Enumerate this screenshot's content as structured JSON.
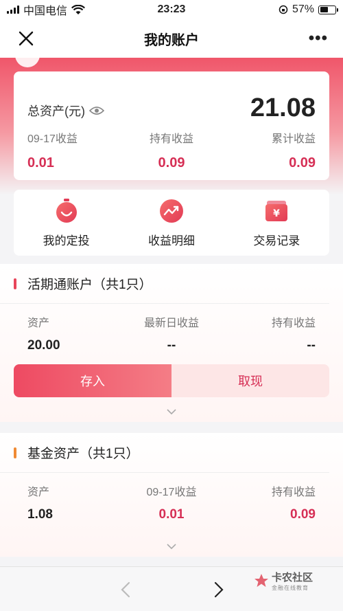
{
  "status_bar": {
    "carrier": "中国电信",
    "time": "23:23",
    "battery": "57%",
    "battery_level": 0.57
  },
  "nav": {
    "title": "我的账户"
  },
  "asset_card": {
    "label": "总资产(元)",
    "total": "21.08",
    "stats": [
      {
        "label": "09-17收益",
        "value": "0.01"
      },
      {
        "label": "持有收益",
        "value": "0.09"
      },
      {
        "label": "累计收益",
        "value": "0.09"
      }
    ]
  },
  "quick_actions": [
    {
      "label": "我的定投",
      "icon": "timer-smile-icon"
    },
    {
      "label": "收益明细",
      "icon": "trend-chart-icon"
    },
    {
      "label": "交易记录",
      "icon": "yen-wallet-icon"
    }
  ],
  "current_account": {
    "title": "活期通账户（共1只）",
    "bar_color": "#e8455a",
    "columns": [
      {
        "label": "资产",
        "value": "20.00"
      },
      {
        "label": "最新日收益",
        "value": "--"
      },
      {
        "label": "持有收益",
        "value": "--"
      }
    ],
    "deposit_label": "存入",
    "withdraw_label": "取现"
  },
  "fund_account": {
    "title": "基金资产（共1只）",
    "bar_color": "#f08a34",
    "columns": [
      {
        "label": "资产",
        "value": "1.08"
      },
      {
        "label": "09-17收益",
        "value": "0.01"
      },
      {
        "label": "持有收益",
        "value": "0.09"
      }
    ]
  },
  "watermark": {
    "title": "卡农社区",
    "subtitle": "金融在线教育"
  },
  "colors": {
    "accent": "#d62f55",
    "hero": "#f0566a"
  }
}
